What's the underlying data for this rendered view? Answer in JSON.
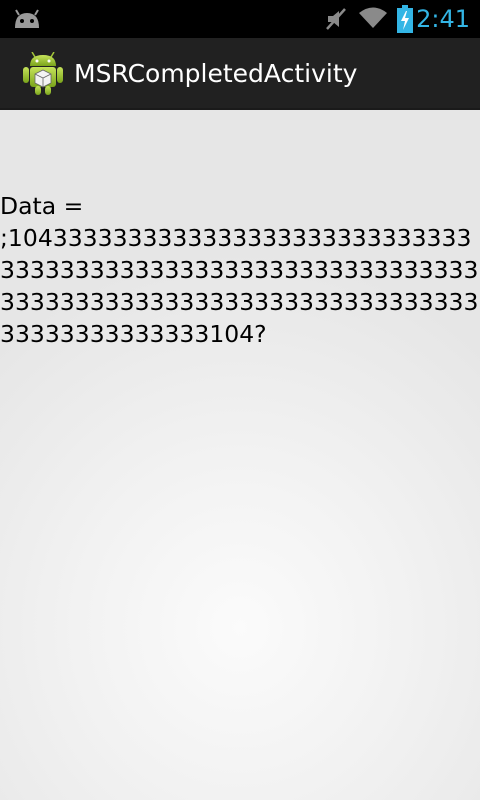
{
  "status_bar": {
    "time": "2:41",
    "icons": [
      "android-notification-icon",
      "muted-icon",
      "wifi-icon",
      "battery-charging-icon"
    ],
    "clock_color": "#33b5e5"
  },
  "action_bar": {
    "title": "MSRCompletedActivity",
    "icon": "android-app-icon",
    "background": "#212121"
  },
  "main": {
    "label": "Data =",
    "value": ";1043333333333333333333333333333333333333333333333333333333333333333333333333333333333333333333333333333333333104?"
  }
}
